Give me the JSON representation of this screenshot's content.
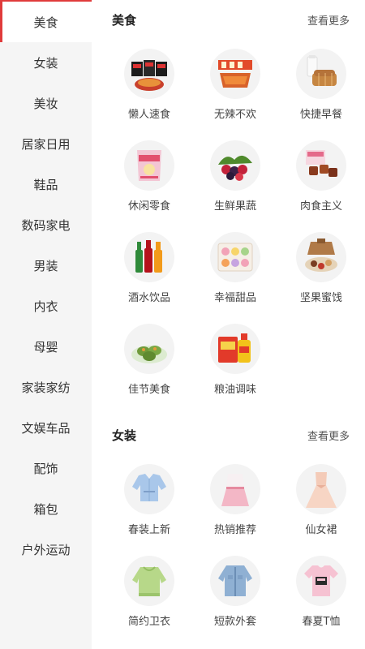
{
  "sidebar": {
    "items": [
      {
        "label": "美食",
        "active": true
      },
      {
        "label": "女装"
      },
      {
        "label": "美妆"
      },
      {
        "label": "居家日用"
      },
      {
        "label": "鞋品"
      },
      {
        "label": "数码家电"
      },
      {
        "label": "男装"
      },
      {
        "label": "内衣"
      },
      {
        "label": "母婴"
      },
      {
        "label": "家装家纺"
      },
      {
        "label": "文娱车品"
      },
      {
        "label": "配饰"
      },
      {
        "label": "箱包"
      },
      {
        "label": "户外运动"
      }
    ]
  },
  "sections": [
    {
      "title": "美食",
      "more": "查看更多",
      "items": [
        {
          "label": "懒人速食",
          "icon": "instant-noodles-icon"
        },
        {
          "label": "无辣不欢",
          "icon": "spicy-snack-icon"
        },
        {
          "label": "快捷早餐",
          "icon": "bread-milk-icon"
        },
        {
          "label": "休闲零食",
          "icon": "snack-bag-icon"
        },
        {
          "label": "生鲜果蔬",
          "icon": "berries-icon"
        },
        {
          "label": "肉食主义",
          "icon": "meat-icon"
        },
        {
          "label": "酒水饮品",
          "icon": "drink-bottles-icon"
        },
        {
          "label": "幸福甜品",
          "icon": "macaron-icon"
        },
        {
          "label": "坚果蜜饯",
          "icon": "nuts-icon"
        },
        {
          "label": "佳节美食",
          "icon": "rice-cake-icon"
        },
        {
          "label": "粮油调味",
          "icon": "oil-rice-icon"
        }
      ]
    },
    {
      "title": "女装",
      "more": "查看更多",
      "items": [
        {
          "label": "春装上新",
          "icon": "blouse-icon"
        },
        {
          "label": "热销推荐",
          "icon": "dress-outfit-icon"
        },
        {
          "label": "仙女裙",
          "icon": "fairy-dress-icon"
        },
        {
          "label": "简约卫衣",
          "icon": "hoodie-icon"
        },
        {
          "label": "短款外套",
          "icon": "denim-jacket-icon"
        },
        {
          "label": "春夏T恤",
          "icon": "tshirt-icon"
        }
      ]
    }
  ],
  "colors": {
    "accent": "#e03b3b",
    "sidebar_bg": "#f5f5f5"
  }
}
